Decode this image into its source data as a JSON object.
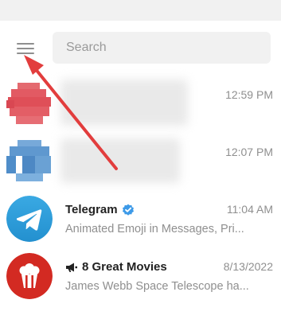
{
  "header": {
    "menu_icon": "hamburger-menu-icon",
    "search": {
      "placeholder": "Search",
      "value": ""
    }
  },
  "colors": {
    "telegram_blue": "#2f9fd9",
    "verified": "#3d9ae8",
    "movies_red": "#d32a22",
    "annotation_arrow": "#e23d3d",
    "muted_text": "#8f8f8f"
  },
  "chats": [
    {
      "title": "",
      "time": "12:59 PM",
      "preview": ""
    },
    {
      "title": "",
      "time": "12:07 PM",
      "preview": ""
    },
    {
      "title": "Telegram",
      "time": "11:04 AM",
      "preview": "Animated Emoji in Messages, Pri...",
      "verified": true,
      "avatar_icon": "telegram-plane-icon"
    },
    {
      "title": "8 Great Movies",
      "time": "8/13/2022",
      "preview": "James Webb Space Telescope ha...",
      "channel_icon": "megaphone-icon",
      "avatar_icon": "popcorn-icon"
    }
  ]
}
